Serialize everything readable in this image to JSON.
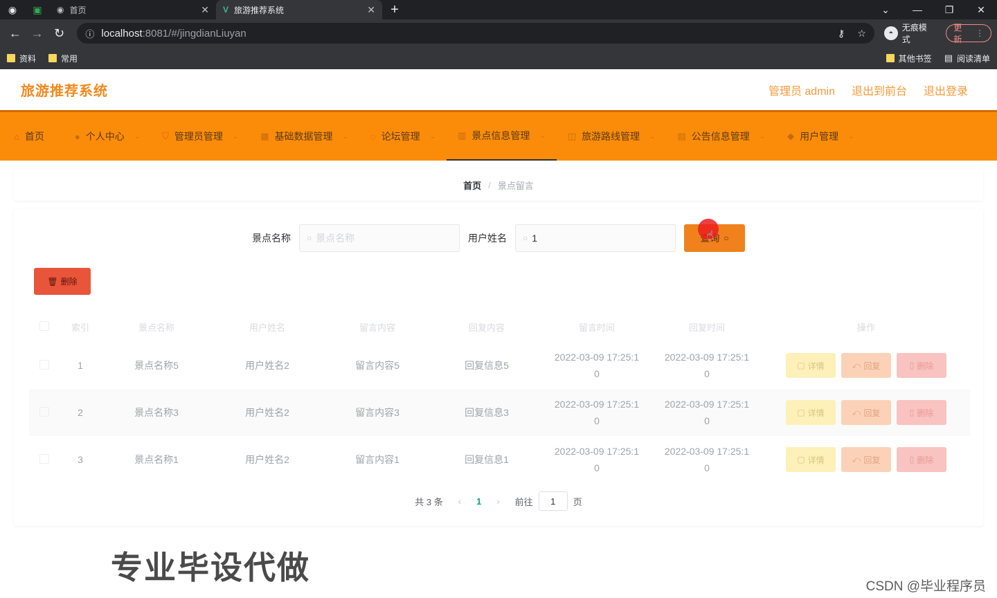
{
  "browser": {
    "tabs": [
      {
        "title": "首页",
        "active": false
      },
      {
        "title": "旅游推荐系统",
        "active": true
      }
    ],
    "url_host": "localhost",
    "url_path": ":8081/#/jingdianLiuyan",
    "incognito_label": "无痕模式",
    "update_label": "更新",
    "bookmarks": [
      "资料",
      "常用"
    ],
    "bookmarks_right": [
      "其他书签",
      "阅读清单"
    ]
  },
  "app": {
    "title": "旅游推荐系统",
    "header_links": [
      "管理员 admin",
      "退出到前台",
      "退出登录"
    ]
  },
  "menu": [
    {
      "label": "首页",
      "icon": "home-icon",
      "has_arrow": false
    },
    {
      "label": "个人中心",
      "icon": "user-icon",
      "has_arrow": true
    },
    {
      "label": "管理员管理",
      "icon": "shield-icon",
      "has_arrow": true
    },
    {
      "label": "基础数据管理",
      "icon": "grid-icon",
      "has_arrow": true
    },
    {
      "label": "论坛管理",
      "icon": "chat-icon",
      "has_arrow": true
    },
    {
      "label": "景点信息管理",
      "icon": "scenic-icon",
      "has_arrow": true,
      "active": true
    },
    {
      "label": "旅游路线管理",
      "icon": "route-icon",
      "has_arrow": true
    },
    {
      "label": "公告信息管理",
      "icon": "notice-icon",
      "has_arrow": true
    },
    {
      "label": "用户管理",
      "icon": "users-icon",
      "has_arrow": true
    }
  ],
  "breadcrumb": {
    "home": "首页",
    "sep": "/",
    "current": "景点留言"
  },
  "search": {
    "label1": "景点名称",
    "placeholder1": "景点名称",
    "value1": "",
    "label2": "用户姓名",
    "value2": "1",
    "button_label": "查询"
  },
  "delete_button": "删除",
  "table": {
    "headers": [
      "索引",
      "景点名称",
      "用户姓名",
      "留言内容",
      "回复内容",
      "留言时间",
      "回复时间",
      "操作"
    ],
    "rows": [
      {
        "index": "1",
        "name": "景点名称5",
        "user": "用户姓名2",
        "content": "留言内容5",
        "reply": "回复信息5",
        "msg_time_a": "2022-03-09 17:25:1",
        "msg_time_b": "0",
        "reply_time_a": "2022-03-09 17:25:1",
        "reply_time_b": "0"
      },
      {
        "index": "2",
        "name": "景点名称3",
        "user": "用户姓名2",
        "content": "留言内容3",
        "reply": "回复信息3",
        "msg_time_a": "2022-03-09 17:25:1",
        "msg_time_b": "0",
        "reply_time_a": "2022-03-09 17:25:1",
        "reply_time_b": "0"
      },
      {
        "index": "3",
        "name": "景点名称1",
        "user": "用户姓名2",
        "content": "留言内容1",
        "reply": "回复信息1",
        "msg_time_a": "2022-03-09 17:25:1",
        "msg_time_b": "0",
        "reply_time_a": "2022-03-09 17:25:1",
        "reply_time_b": "0"
      }
    ],
    "op_labels": {
      "detail": "详情",
      "reply": "回复",
      "delete": "删除"
    }
  },
  "pagination": {
    "total": "共 3 条",
    "current": "1",
    "goto_label": "前往",
    "goto_value": "1",
    "page_suffix": "页"
  },
  "overlay": {
    "watermark": "专业毕设代做",
    "credit": "CSDN @毕业程序员"
  },
  "colors": {
    "menu_bg": "#fb8c09",
    "title": "#f08a1e",
    "search_btn": "#f0811c",
    "delete_btn": "#e8553a"
  }
}
